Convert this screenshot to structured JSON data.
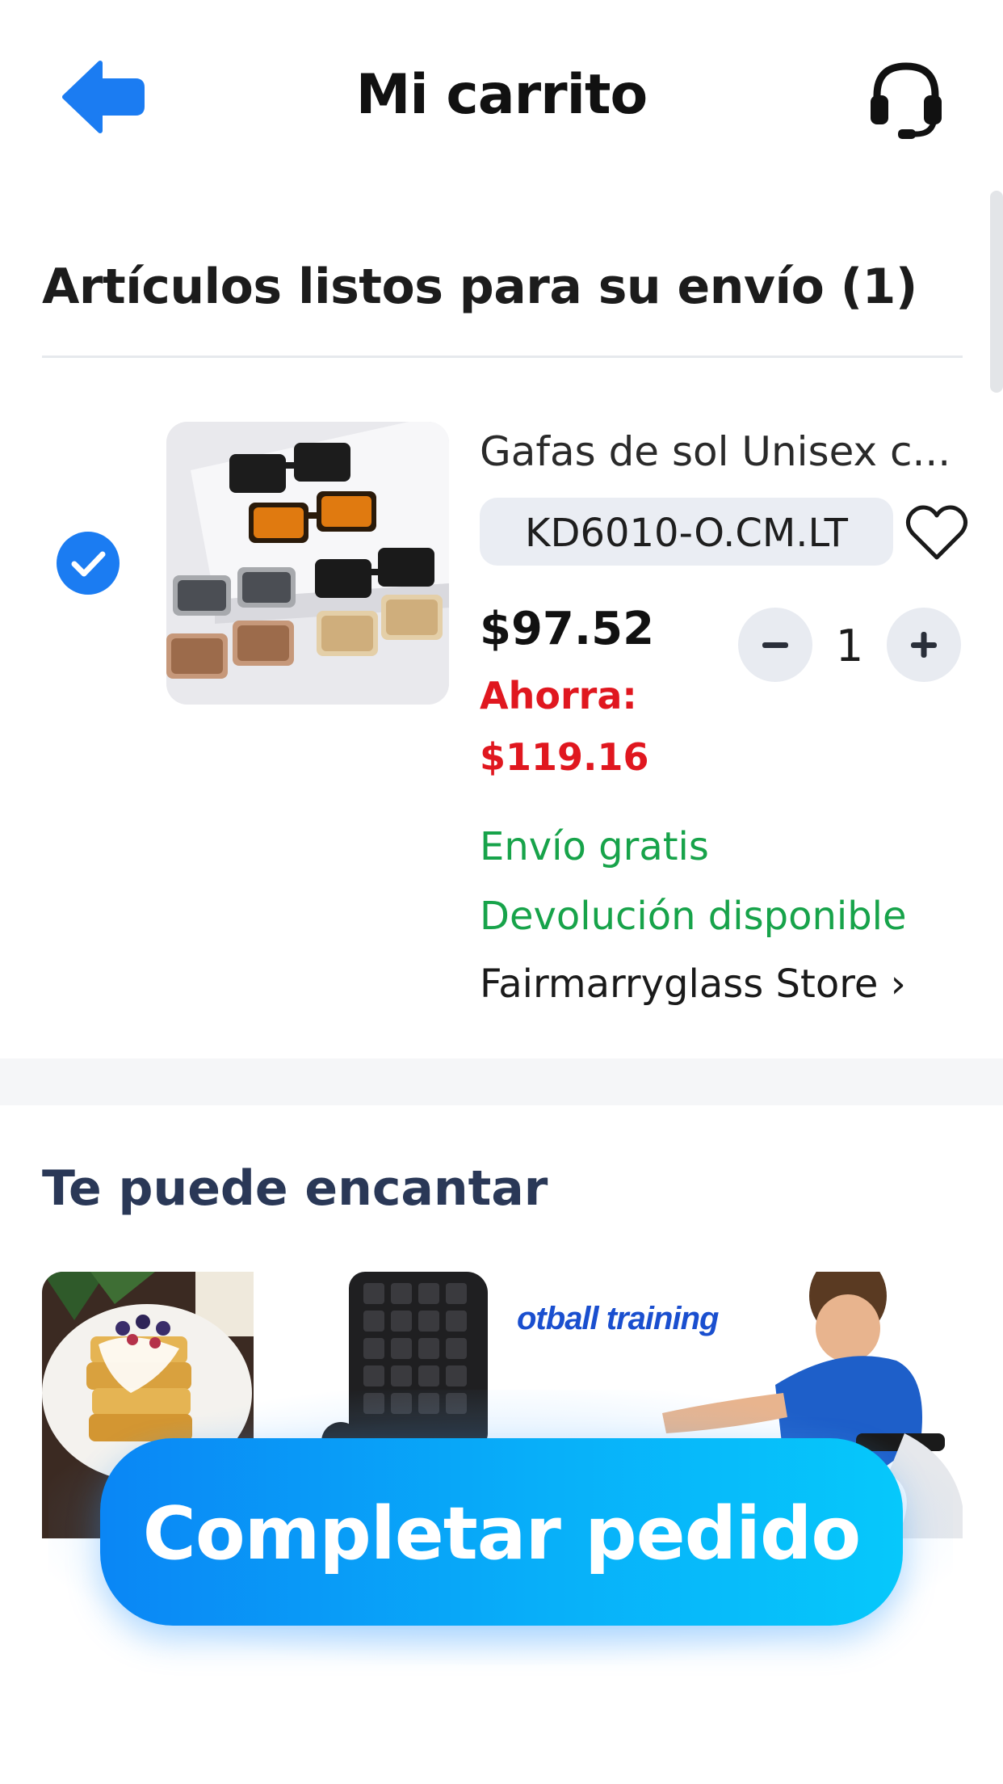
{
  "header": {
    "title": "Mi carrito",
    "back_icon": "back-arrow-icon",
    "support_icon": "headset-icon"
  },
  "cart": {
    "section_title": "Artículos listos para su envío (1)",
    "items": [
      {
        "selected": true,
        "name": "Gafas de sol Unisex c...",
        "variant": "KD6010-O.CM.LT",
        "price": "$97.52",
        "saving_label": "Ahorra:",
        "saving_amount": "$119.16",
        "quantity": "1",
        "shipping": "Envío gratis",
        "returns": "Devolución disponible",
        "store": "Fairmarryglass Store ›",
        "favorite_icon": "heart-outline-icon"
      }
    ]
  },
  "recommendations": {
    "title": "Te puede encantar",
    "cards": [
      {
        "image": "waffles-and-waffle-maker"
      },
      {
        "image": "boy-football-training",
        "caption": "otball training"
      }
    ]
  },
  "checkout": {
    "button_label": "Completar pedido"
  },
  "colors": {
    "accent": "#1b7cf2",
    "saving": "#e0171f",
    "success": "#17a34a",
    "cta_start": "#0a86f5",
    "cta_end": "#06c8fb"
  }
}
